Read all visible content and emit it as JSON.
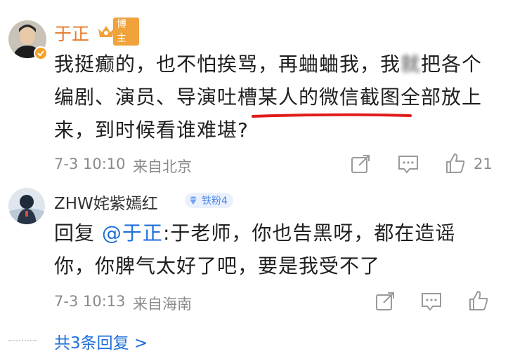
{
  "comment": {
    "username": "于正",
    "badge_label": "博主",
    "text_line1": "我挺癫的，也不怕挨骂，再蛐蛐我，我",
    "text_line1_obscured": "就",
    "text_line1_end": "把各个",
    "text_line2": "编剧、演员、导演吐槽某人的微信截图全部放上",
    "text_line3": "来，到时候看谁难堪?",
    "time": "7-3 10:10",
    "location": "来自北京",
    "like_count": "21"
  },
  "reply": {
    "username": "ZHW姹紫嫣红",
    "fan_badge": "铁粉4",
    "prefix": "回复",
    "mention": "@于正",
    "text_line1_rest": ":于老师，你也告黑呀，都在造谣",
    "text_line2": "你，你脾气太好了吧，要是我受不了",
    "time": "7-3 10:13",
    "location": "来自海南"
  },
  "more_replies": "共3条回复 >",
  "colors": {
    "username_orange": "#e57a2c",
    "link_blue": "#1e6fd9",
    "underline_red": "#e21b1b"
  },
  "icons": [
    "share-icon",
    "comment-icon",
    "like-icon",
    "crown-icon",
    "diamond-icon",
    "verified-icon"
  ]
}
